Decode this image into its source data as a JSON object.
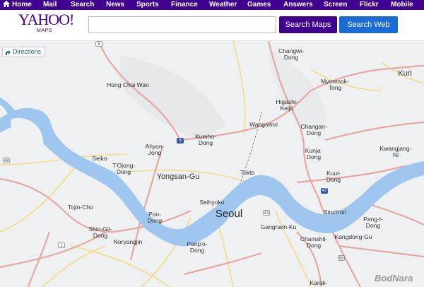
{
  "nav": {
    "items": [
      "Home",
      "Mail",
      "Search",
      "News",
      "Sports",
      "Finance",
      "Weather",
      "Games",
      "Answers",
      "Screen",
      "Flickr",
      "Mobile"
    ]
  },
  "header": {
    "logo_text": "YAHOO!",
    "logo_sub": "MAPS",
    "search_value": "",
    "btn_maps": "Search Maps",
    "btn_web": "Search Web"
  },
  "map": {
    "directions_label": "Directions",
    "labels": {
      "changwi": "Changwi-\nDong",
      "kuri": "Kuri",
      "hongchaiwan": "Hong Chai Wan",
      "myeonmok": "Myonmok-\nTong",
      "higashi": "Higashi-\nKeijo",
      "changan": "Changan-\nDong",
      "kumho": "Kumho-\nDong",
      "wangsimri": "Wangsimri",
      "ahyon": "Ahyon-\nJong",
      "kunja": "Kunja-\nDong",
      "kwangjang": "Kwangjang-Ni",
      "seiko": "Seiko",
      "tojong": "T'Ojong-\nDong",
      "yongsan": "Yongsan-Gu",
      "tokto": "Tokto",
      "kuui": "Kuui-\nDong",
      "tojin": "Tojin-Cho",
      "seihyoko": "Seihyoko",
      "seoul": "Seoul",
      "sinchon": "Sinch'on",
      "pangi": "Pang-I-\nDong",
      "pondong": "Pon-\nDong",
      "shingil": "Shin-Gil-\nDong",
      "gangnam": "Gangnam-Ku",
      "chamshil": "Chamshil-\nDong",
      "kangdong": "Kangdong-Gu",
      "noryang": "Noryangjin",
      "panpo": "Panp'o-\nDong",
      "karak": "Karak-"
    },
    "shields": {
      "s6a": "6",
      "s6b": "6",
      "s48": "48",
      "s1": "1",
      "s43": "43",
      "s47": "47",
      "s88": "88"
    }
  },
  "watermark": "BodNara",
  "colors": {
    "nav_bg": "#400090",
    "maps_btn": "#400090",
    "web_btn": "#1a6bd6",
    "water": "#9ec6ef",
    "road_major": "#e8a7a0",
    "road_yellow": "#f3dc85"
  }
}
